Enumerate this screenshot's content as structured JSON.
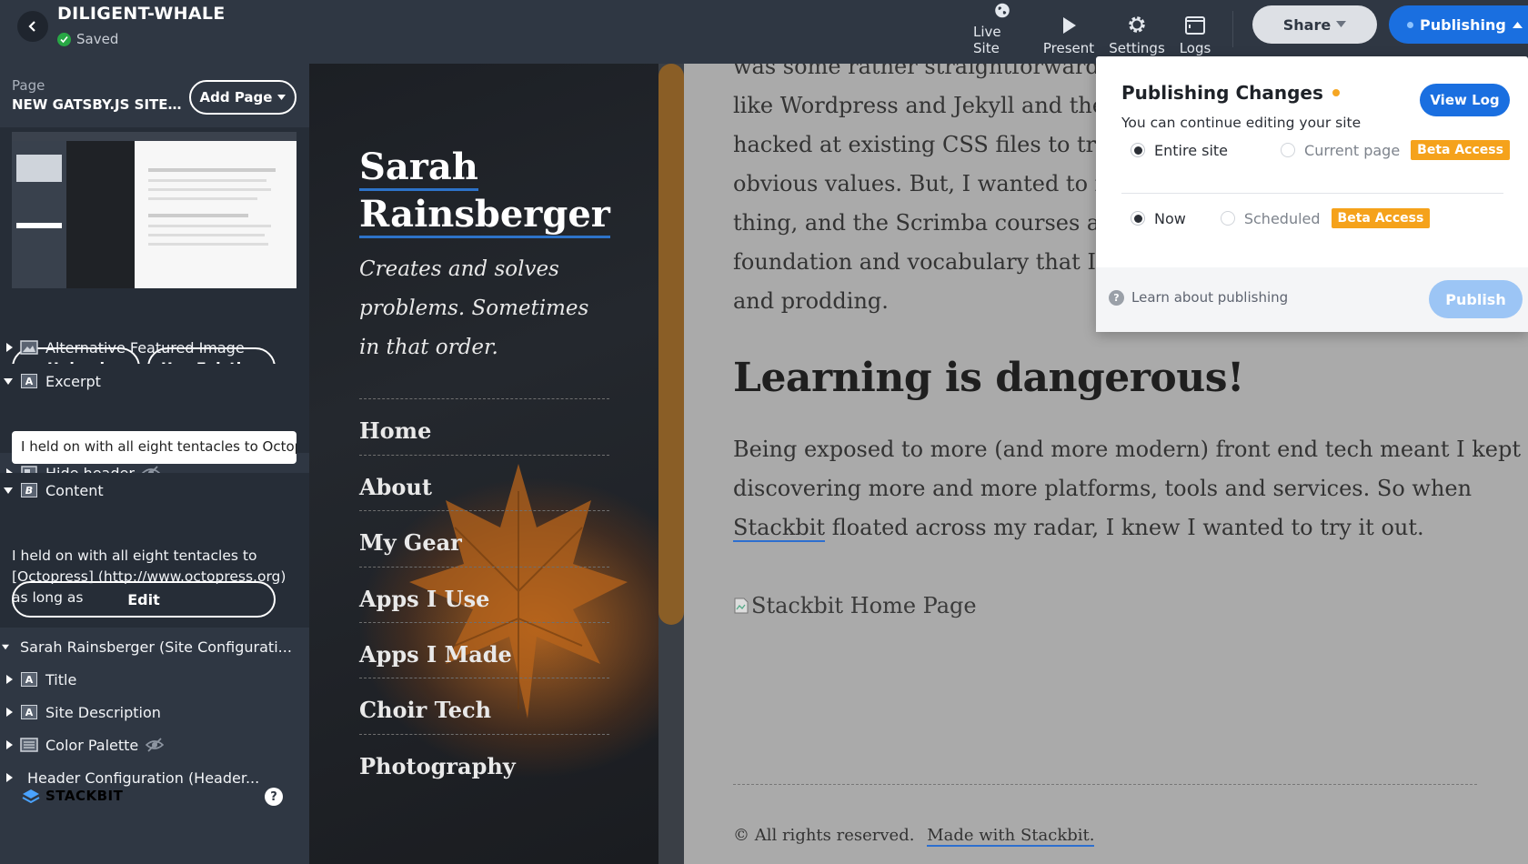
{
  "topbar": {
    "site_name": "DILIGENT-WHALE",
    "status": "Saved",
    "live_site": "Live Site",
    "present": "Present",
    "settings": "Settings",
    "logs": "Logs",
    "share": "Share",
    "publishing": "Publishing"
  },
  "sidebar": {
    "page_label": "Page",
    "page_name": "NEW GATSBY.JS SITE V...",
    "add_page": "Add Page",
    "upload": "Upload",
    "use_existing": "Use Existing",
    "alt_featured_image": "Alternative Featured Image",
    "excerpt": "Excerpt",
    "excerpt_value": "I held on with all eight tentacles to Octopress",
    "hide_header": "Hide header",
    "content": "Content",
    "content_text": "I held on with all eight tentacles to [Octopress] (http://www.octopress.org) as long as",
    "edit": "Edit",
    "site_config": "Sarah Rainsberger (Site Configurati...",
    "title": "Title",
    "site_description": "Site Description",
    "color_palette": "Color Palette",
    "header_config": "Header Configuration (Header...",
    "brand": "STACKBIT"
  },
  "site": {
    "title_line1": "Sarah",
    "title_line2": "Rainsberger",
    "description": "Creates and solves problems. Sometimes in that order.",
    "nav": [
      "Home",
      "About",
      "My Gear",
      "Apps I Use",
      "Apps I Made",
      "Choir Tech",
      "Photography"
    ]
  },
  "article": {
    "p1_lines": [
      "was some rather straightforward H",
      "like Wordpress and Jekyll and the a",
      "hacked at existing CSS files to try t",
      "obvious values. But, I wanted to fee",
      "thing, and the Scrimba courses are",
      "foundation and vocabulary that I ju",
      "and prodding."
    ],
    "heading": "Learning is dangerous!",
    "p2_line1": "Being exposed to more (and more modern) front end tech meant I kept",
    "p2_line2": "discovering more and more platforms, tools and services. So when",
    "p2_link": "Stackbit",
    "p2_line3_rest": " floated across my radar, I knew I wanted to try it out.",
    "image_alt": "Stackbit Home Page",
    "footer_text": "© All rights reserved.",
    "footer_link": "Made with Stackbit."
  },
  "popover": {
    "title": "Publishing Changes",
    "subtitle": "You can continue editing your site",
    "view_log": "View Log",
    "scope_entire": "Entire site",
    "scope_current": "Current page",
    "beta": "Beta Access",
    "when_now": "Now",
    "when_scheduled": "Scheduled",
    "learn": "Learn about publishing",
    "publish": "Publish"
  },
  "colors": {
    "topbar_bg": "#2f3743",
    "accent_blue": "#1a6fe0",
    "beta_orange": "#f5a21b",
    "saved_green": "#28a745"
  }
}
